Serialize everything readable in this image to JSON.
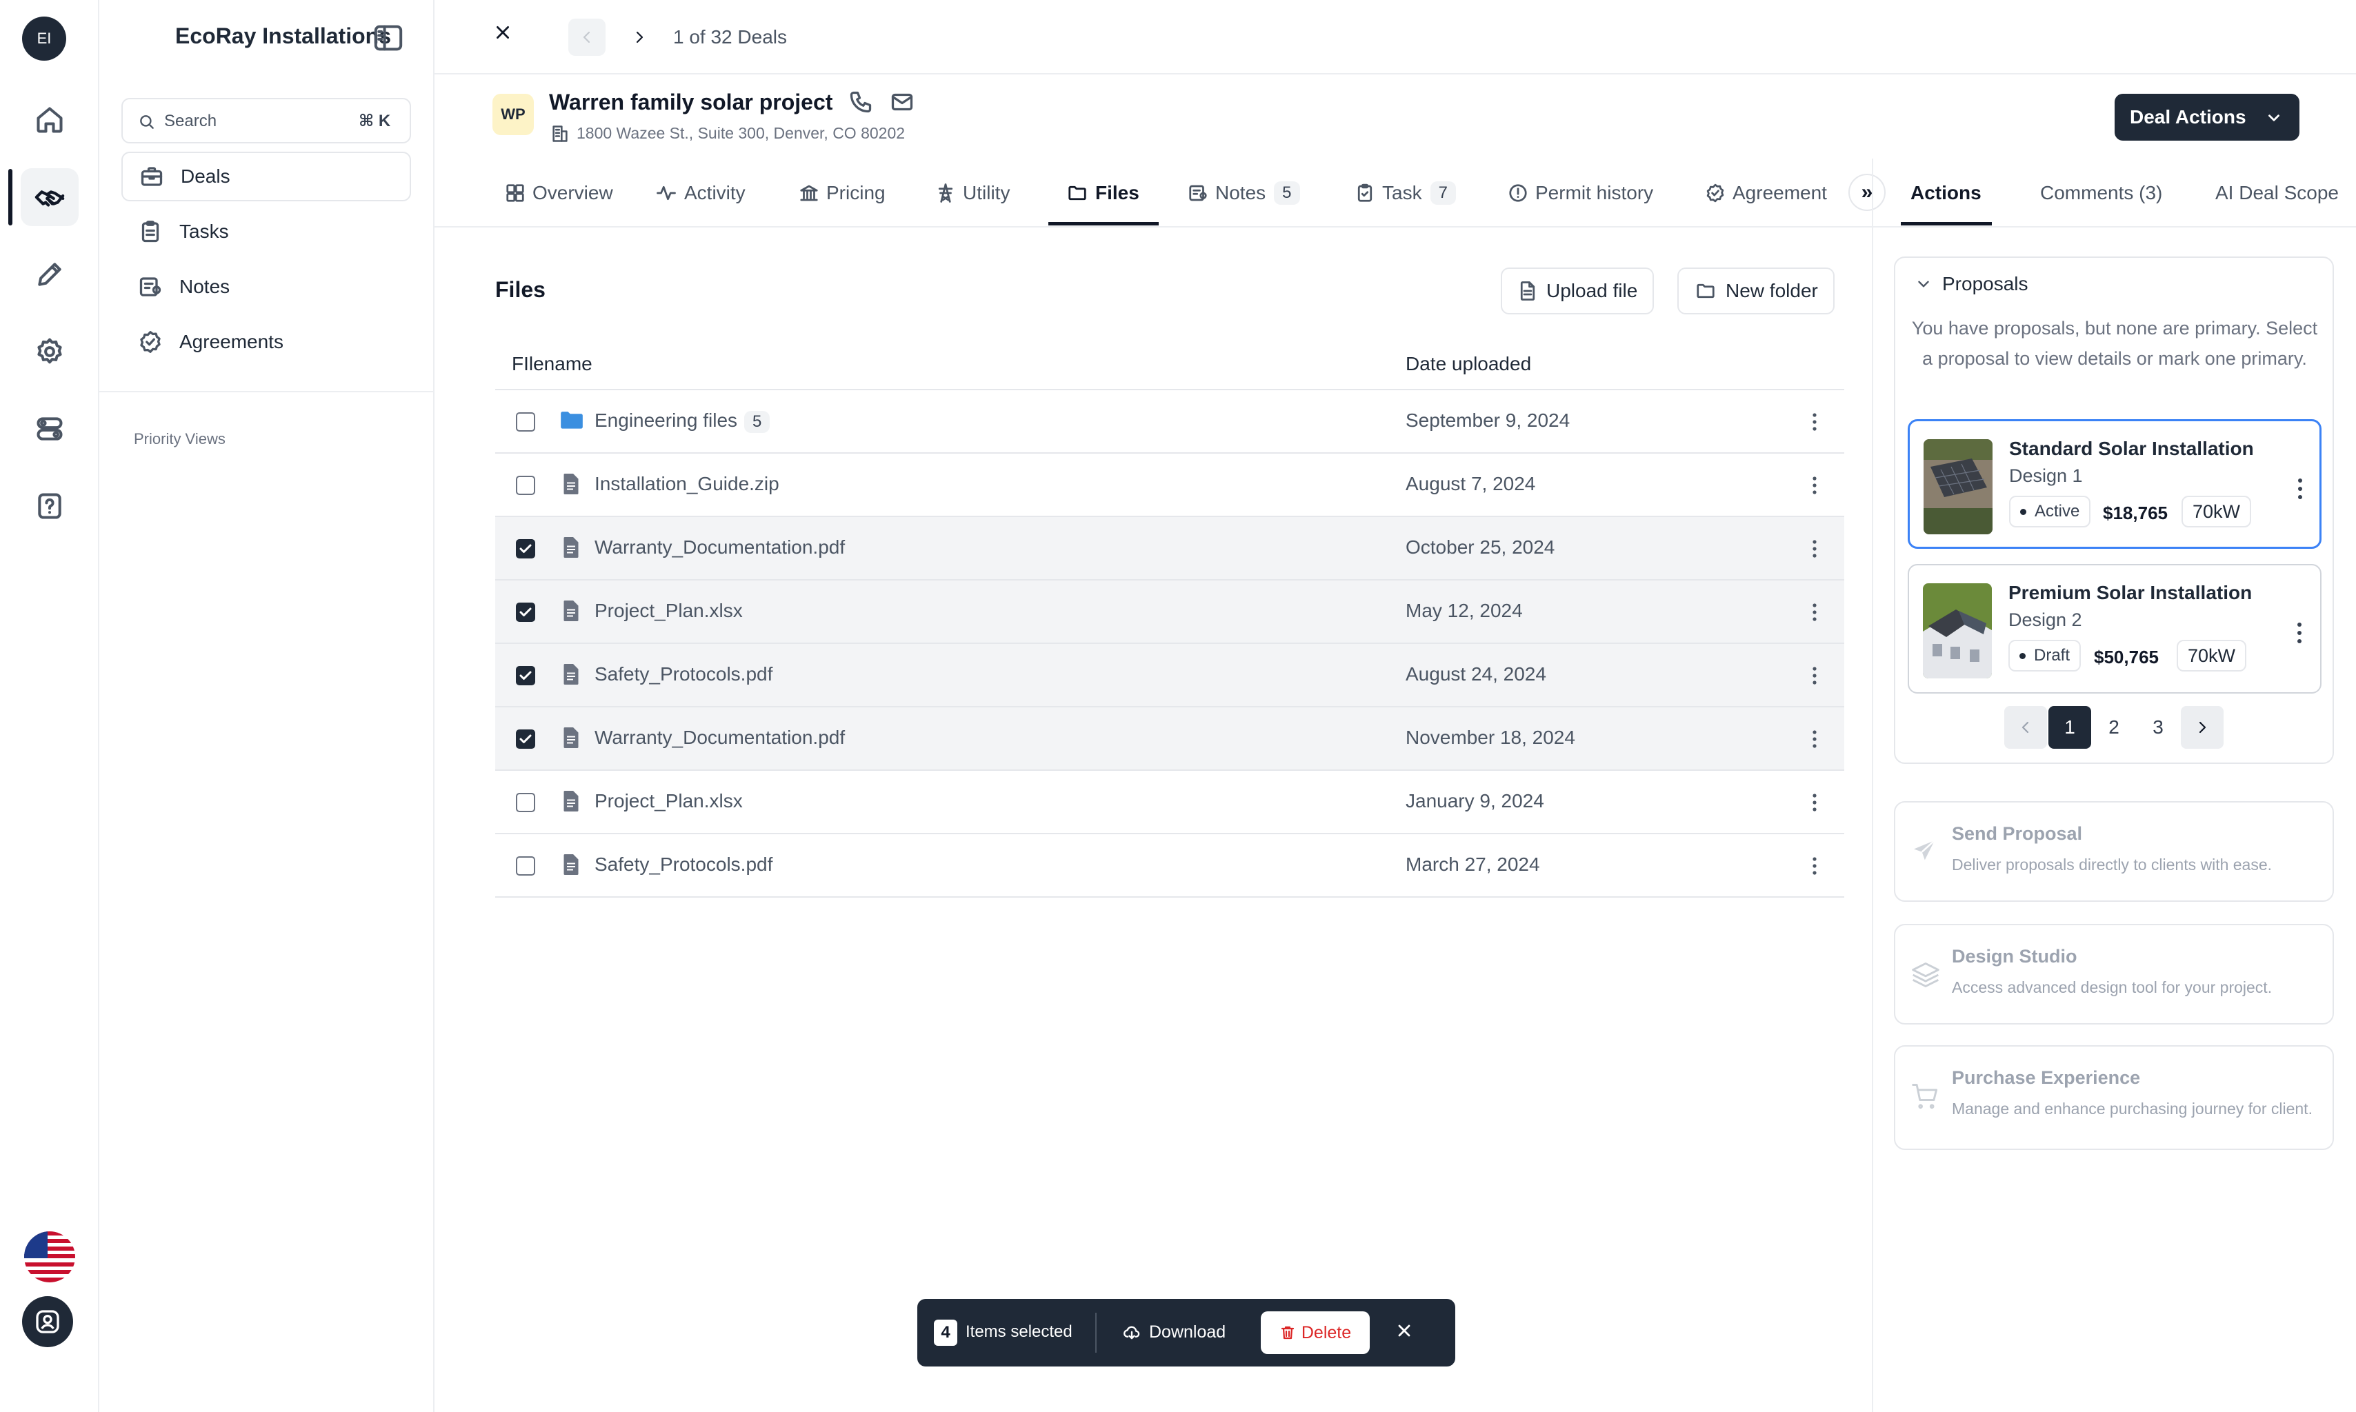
{
  "app": {
    "initials": "EI",
    "name": "EcoRay Installations"
  },
  "rail": {
    "icons": [
      "home-icon",
      "handshake-icon",
      "pencil-icon",
      "settings-icon",
      "toggles-icon",
      "help-icon"
    ],
    "active": "handshake-icon"
  },
  "search": {
    "label": "Search",
    "shortcut": "⌘ K"
  },
  "nav": {
    "items": [
      {
        "label": "Deals",
        "icon": "briefcase-icon",
        "active": true
      },
      {
        "label": "Tasks",
        "icon": "clipboard-icon"
      },
      {
        "label": "Notes",
        "icon": "notes-icon"
      },
      {
        "label": "Agreements",
        "icon": "badge-check-icon"
      }
    ],
    "priority_label": "Priority Views"
  },
  "header": {
    "deal_counter": "1 of 32 Deals"
  },
  "deal": {
    "initials": "WP",
    "title": "Warren family solar project",
    "address": "1800 Wazee St., Suite 300, Denver, CO 80202",
    "actions_label": "Deal Actions"
  },
  "tabs": [
    {
      "label": "Overview",
      "icon": "grid-icon"
    },
    {
      "label": "Activity",
      "icon": "pulse-icon"
    },
    {
      "label": "Pricing",
      "icon": "bank-icon"
    },
    {
      "label": "Utility",
      "icon": "tower-icon"
    },
    {
      "label": "Files",
      "icon": "folder-icon",
      "active": true
    },
    {
      "label": "Notes",
      "icon": "notes-icon",
      "count": "5"
    },
    {
      "label": "Task",
      "icon": "clipboard-icon",
      "count": "7"
    },
    {
      "label": "Permit history",
      "icon": "alert-circle-icon"
    },
    {
      "label": "Agreement",
      "icon": "badge-check-icon"
    }
  ],
  "expand_label": "»",
  "right_tabs": [
    {
      "label": "Actions",
      "active": true
    },
    {
      "label": "Comments (3)"
    },
    {
      "label": "AI Deal Scope"
    }
  ],
  "files": {
    "title": "Files",
    "upload_label": "Upload file",
    "new_folder_label": "New folder",
    "col_filename": "FIlename",
    "col_date": "Date uploaded",
    "rows": [
      {
        "name": "Engineering files",
        "count": "5",
        "type": "folder",
        "date": "September 9, 2024",
        "checked": false
      },
      {
        "name": "Installation_Guide.zip",
        "type": "file",
        "date": "August 7, 2024",
        "checked": false
      },
      {
        "name": "Warranty_Documentation.pdf",
        "type": "file",
        "date": "October 25, 2024",
        "checked": true
      },
      {
        "name": "Project_Plan.xlsx",
        "type": "file",
        "date": "May 12, 2024",
        "checked": true
      },
      {
        "name": "Safety_Protocols.pdf",
        "type": "file",
        "date": "August 24, 2024",
        "checked": true
      },
      {
        "name": "Warranty_Documentation.pdf",
        "type": "file",
        "date": "November 18, 2024",
        "checked": true
      },
      {
        "name": "Project_Plan.xlsx",
        "type": "file",
        "date": "January 9, 2024",
        "checked": false
      },
      {
        "name": "Safety_Protocols.pdf",
        "type": "file",
        "date": "March 27, 2024",
        "checked": false
      }
    ]
  },
  "selection_bar": {
    "count": "4",
    "label": "Items selected",
    "download_label": "Download",
    "delete_label": "Delete"
  },
  "proposals": {
    "title": "Proposals",
    "message": "You have proposals, but none are primary. Select a proposal to view details or mark one primary.",
    "items": [
      {
        "title": "Standard Solar Installation",
        "design": "Design 1",
        "status": "Active",
        "price": "$18,765",
        "size": "70kW"
      },
      {
        "title": "Premium Solar Installation",
        "design": "Design 2",
        "status": "Draft",
        "price": "$50,765",
        "size": "70kW"
      }
    ],
    "pages": [
      "1",
      "2",
      "3"
    ],
    "current_page": "1"
  },
  "features": [
    {
      "title": "Send Proposal",
      "desc": "Deliver proposals directly to clients with ease.",
      "icon": "send-icon"
    },
    {
      "title": "Design Studio",
      "desc": "Access advanced design tool for your project.",
      "icon": "layers-icon"
    },
    {
      "title": "Purchase Experience",
      "desc": "Manage and enhance purchasing journey for client.",
      "icon": "cart-icon"
    }
  ],
  "colors": {
    "dark": "#1f2937",
    "primary_border": "#3b82f6",
    "delete": "#dc2626",
    "folder": "#3b8fe0"
  }
}
